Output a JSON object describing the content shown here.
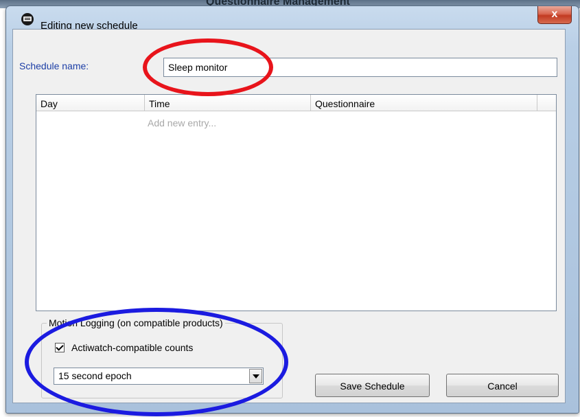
{
  "background_window": {
    "title_fragment": "Questionnaire Management"
  },
  "window": {
    "title": "Editing new schedule",
    "close_label": "x"
  },
  "schedule": {
    "name_label": "Schedule name:",
    "name_value": "Sleep monitor"
  },
  "entries": {
    "columns": [
      "Day",
      "Time",
      "Questionnaire"
    ],
    "add_entry_label": "Add new entry...",
    "rows": []
  },
  "motion_logging": {
    "group_label": "Motion Logging (on compatible products)",
    "checkbox_label": "Actiwatch-compatible counts",
    "checkbox_checked": true,
    "epoch_selected": "15 second epoch"
  },
  "buttons": {
    "save": "Save Schedule",
    "cancel": "Cancel"
  },
  "annotations": {
    "highlight_name_color": "#e8141b",
    "highlight_motion_color": "#1b1be0"
  },
  "colors": {
    "label_blue": "#1c3ea6",
    "placeholder_gray": "#a8a8a8",
    "close_red": "#c23b22"
  },
  "icons": {
    "app": "camera-device-icon",
    "close": "close-icon",
    "dropdown": "chevron-down-icon",
    "checkbox": "check-icon"
  }
}
